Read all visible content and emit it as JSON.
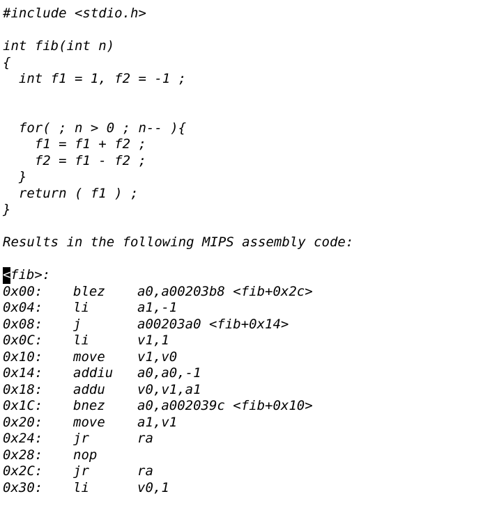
{
  "code": {
    "include": "#include <stdio.h>",
    "signature": "int fib(int n)",
    "open_brace": "{",
    "decl": "  int f1 = 1, f2 = -1 ;",
    "for_line": "  for( ; n > 0 ; n-- ){",
    "body1": "    f1 = f1 + f2 ;",
    "body2": "    f2 = f1 - f2 ;",
    "inner_close": "  }",
    "return_line": "  return ( f1 ) ;",
    "close_brace": "}"
  },
  "caption": "Results in the following MIPS assembly code:",
  "asm": {
    "label_cursor": "<",
    "label_rest": "fib>:",
    "rows": [
      {
        "addr": "0x00:",
        "op": "blez",
        "args": "a0,a00203b8 <fib+0x2c>"
      },
      {
        "addr": "0x04:",
        "op": "li",
        "args": "a1,-1"
      },
      {
        "addr": "0x08:",
        "op": "j",
        "args": "a00203a0 <fib+0x14>"
      },
      {
        "addr": "0x0C:",
        "op": "li",
        "args": "v1,1"
      },
      {
        "addr": "0x10:",
        "op": "move",
        "args": "v1,v0"
      },
      {
        "addr": "0x14:",
        "op": "addiu",
        "args": "a0,a0,-1"
      },
      {
        "addr": "0x18:",
        "op": "addu",
        "args": "v0,v1,a1"
      },
      {
        "addr": "0x1C:",
        "op": "bnez",
        "args": "a0,a002039c <fib+0x10>"
      },
      {
        "addr": "0x20:",
        "op": "move",
        "args": "a1,v1"
      },
      {
        "addr": "0x24:",
        "op": "jr",
        "args": "ra"
      },
      {
        "addr": "0x28:",
        "op": "nop",
        "args": ""
      },
      {
        "addr": "0x2C:",
        "op": "jr",
        "args": "ra"
      },
      {
        "addr": "0x30:",
        "op": "li",
        "args": "v0,1"
      }
    ]
  }
}
